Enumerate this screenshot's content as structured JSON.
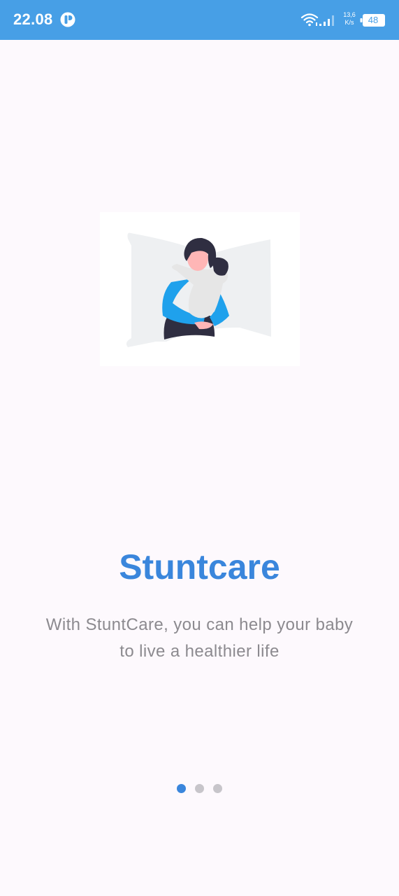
{
  "status_bar": {
    "time": "22.08",
    "network_speed_value": "13,6",
    "network_speed_unit": "K/s",
    "battery_level": "48",
    "background_color": "#479fe6",
    "icons": [
      "notification-app-icon",
      "wifi-icon",
      "cellular-signal-icon",
      "battery-icon"
    ]
  },
  "onboarding": {
    "illustration": "mother-holding-baby-illustration",
    "title": "Stuntcare",
    "description": "With StuntCare, you can help your baby to live a healthier life",
    "page_indicator": {
      "total": 3,
      "active_index": 0
    }
  },
  "colors": {
    "accent": "#3a86dc",
    "subtitle_text": "#8c8a8f",
    "inactive_dot": "#c7c5ca",
    "background": "#fdf9fd"
  }
}
